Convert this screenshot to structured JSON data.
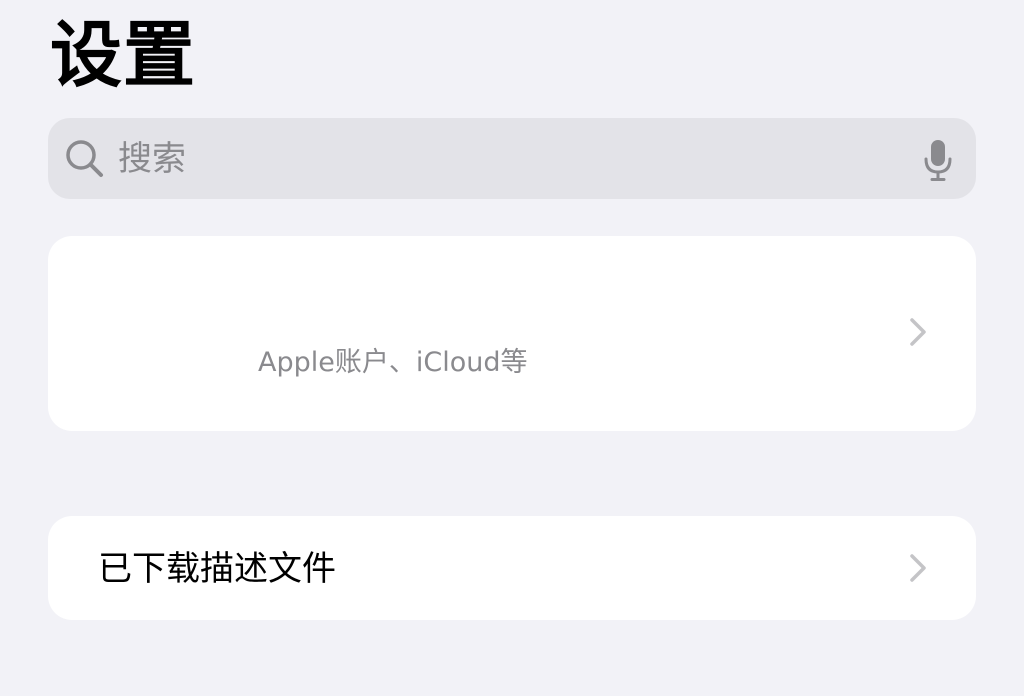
{
  "header": {
    "title": "设置"
  },
  "search": {
    "placeholder": "搜索",
    "icon": "search-icon",
    "mic_icon": "microphone-icon"
  },
  "account_card": {
    "subtitle": "Apple账户、iCloud等",
    "chevron_icon": "chevron-right-icon"
  },
  "profiles_card": {
    "label": "已下载描述文件",
    "chevron_icon": "chevron-right-icon"
  },
  "colors": {
    "background": "#f2f2f7",
    "search_bar": "#e3e3e8",
    "card": "#ffffff",
    "secondary_text": "#8a8a8e",
    "chevron": "#c4c4c7"
  }
}
